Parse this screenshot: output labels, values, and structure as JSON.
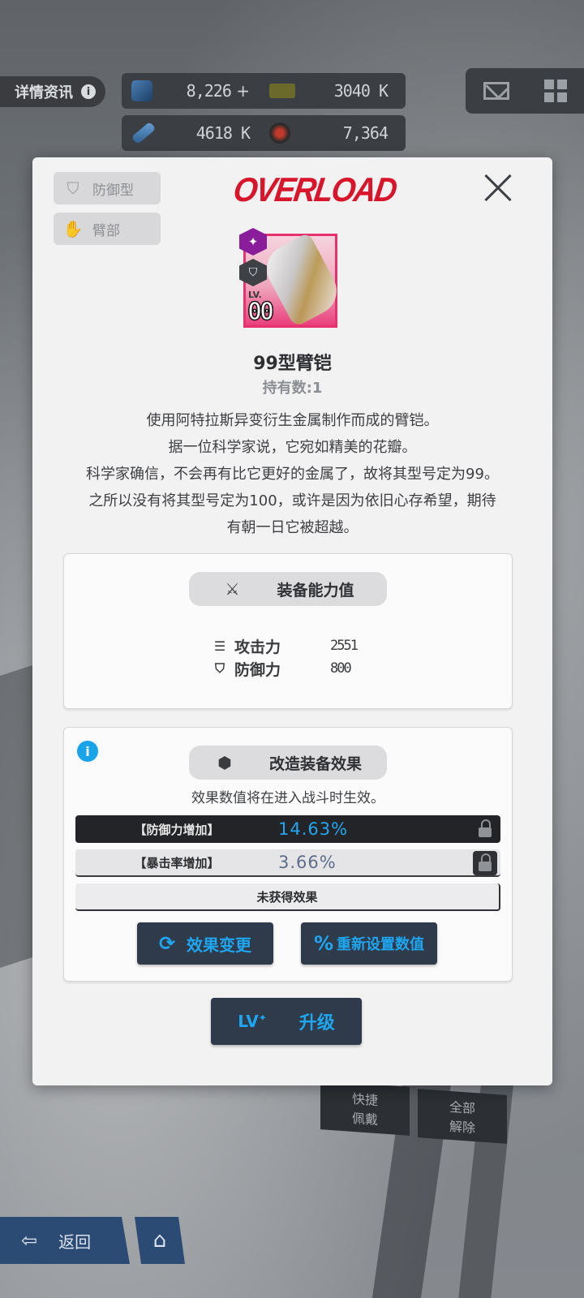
{
  "header": {
    "detail_label": "详情资讯",
    "resources": [
      {
        "icon": "crystal-icon",
        "value": "8,226",
        "plus": "+"
      },
      {
        "icon": "credit-card-icon",
        "value": "3040 K"
      },
      {
        "icon": "battle-data-icon",
        "value": "4618 K"
      },
      {
        "icon": "core-dust-icon",
        "value": "7,364"
      }
    ]
  },
  "modal": {
    "tags": [
      "防御型",
      "臂部"
    ],
    "brand": "OVERLOAD",
    "item": {
      "lv_label": "LV.",
      "level": "00",
      "name": "99型臂铠",
      "owned": "持有数:1",
      "rarity_color": "#e7326f",
      "description": [
        "使用阿特拉斯异变衍生金属制作而成的臂铠。",
        "据一位科学家说，它宛如精美的花瓣。",
        "科学家确信，不会再有比它更好的金属了，故将其型号定为99。",
        "之所以没有将其型号定为100，或许是因为依旧心存希望，期待",
        "有朝一日它被超越。"
      ]
    },
    "stats_panel": {
      "title": "装备能力值",
      "stats": [
        {
          "icon": "attack-icon",
          "label": "攻击力",
          "value": "2551"
        },
        {
          "icon": "defense-icon",
          "label": "防御力",
          "value": "800"
        }
      ]
    },
    "mod_panel": {
      "title": "改造装备效果",
      "note": "效果数值将在进入战斗时生效。",
      "effects": [
        {
          "name": "【防御力增加】",
          "value": "14.63%",
          "style": "dark"
        },
        {
          "name": "【暴击率增加】",
          "value": "3.66%",
          "style": "light"
        }
      ],
      "no_effect": "未获得效果",
      "buttons": {
        "change": "效果变更",
        "reset": "重新设置数值"
      }
    },
    "upgrade": {
      "icon_text": "LV",
      "label": "升级"
    }
  },
  "background_ui": {
    "quick_equip": "快捷\n佩戴",
    "unequip_all": "全部\n解除",
    "back": "返回"
  },
  "colors": {
    "accent": "#1fa6f0",
    "brand_red": "#d8152a",
    "modal_bg": "#f2f2f3"
  }
}
